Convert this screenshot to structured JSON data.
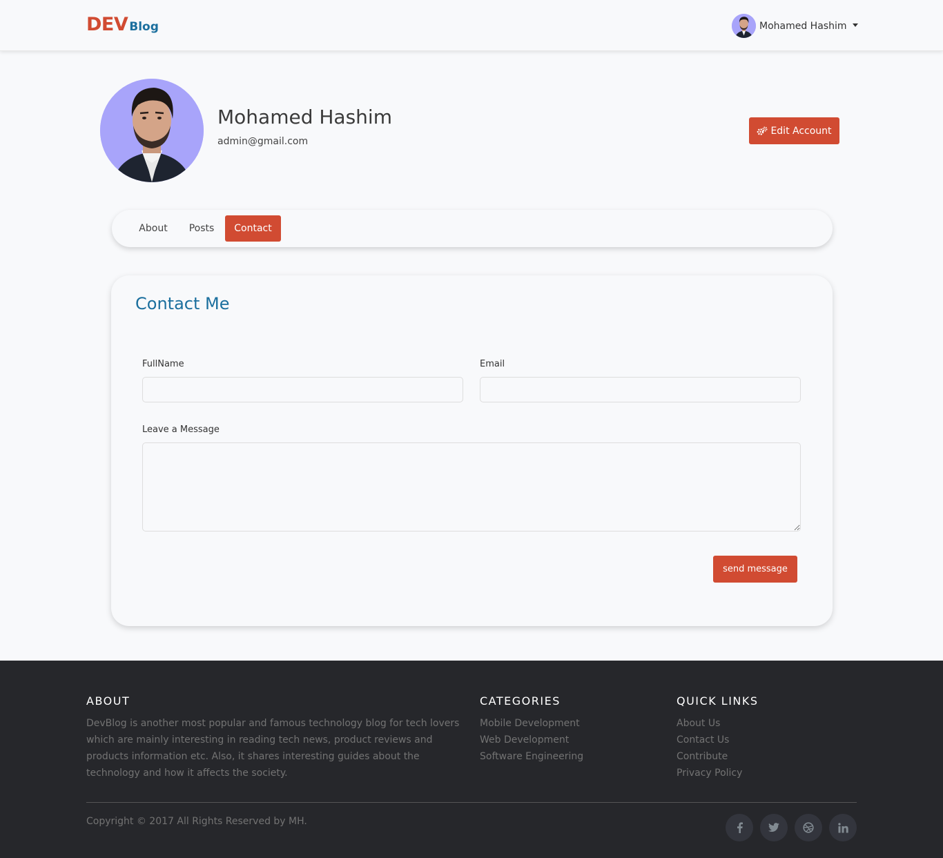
{
  "navbar": {
    "brand_dev": "DEV",
    "brand_blog": "Blog",
    "user_name": "Mohamed Hashim"
  },
  "profile": {
    "name": "Mohamed Hashim",
    "email": "admin@gmail.com",
    "edit_label": "Edit Account"
  },
  "tabs": {
    "about": "About",
    "posts": "Posts",
    "contact": "Contact"
  },
  "contact": {
    "title": "Contact Me",
    "fullname_label": "FullName",
    "email_label": "Email",
    "message_label": "Leave a Message",
    "send_label": "send message"
  },
  "footer": {
    "about_heading": "ABOUT",
    "about_text": "DevBlog is another most popular and famous technology blog for tech lovers which are mainly interesting in reading tech news, product reviews and products information etc. Also, it shares interesting guides about the technology and how it affects the society.",
    "categories_heading": "CATEGORIES",
    "categories": [
      "Mobile Development",
      "Web Development",
      "Software Engineering"
    ],
    "links_heading": "QUICK LINKS",
    "links": [
      "About Us",
      "Contact Us",
      "Contribute",
      "Privacy Policy"
    ],
    "copyright": "Copyright © 2017 All Rights Reserved by MH.",
    "social": [
      "facebook-icon",
      "twitter-icon",
      "dribbble-icon",
      "linkedin-icon"
    ]
  },
  "colors": {
    "accent": "#d14b32",
    "brand_blue": "#1b6f9e",
    "footer_bg": "#26272b",
    "avatar_bg": "#a8a4fa"
  }
}
